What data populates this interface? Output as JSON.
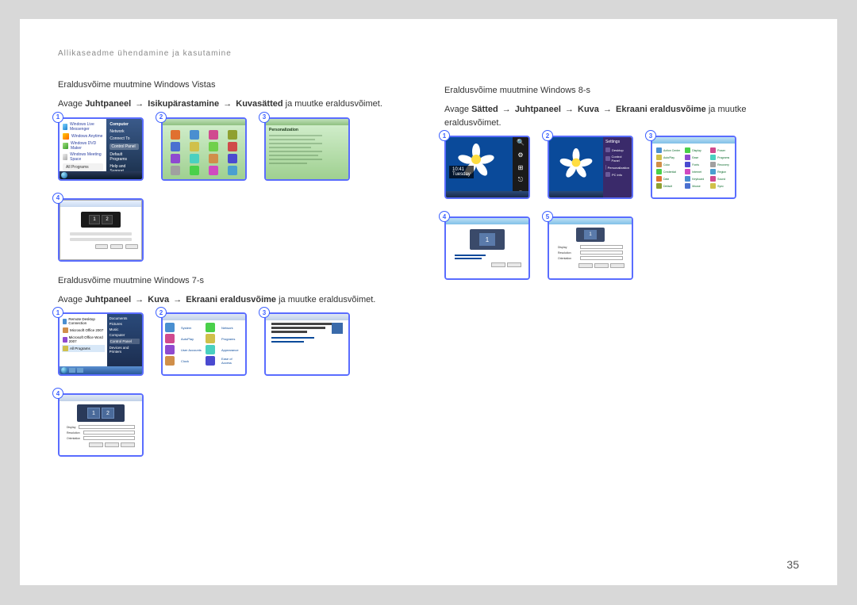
{
  "header": "Allikaseadme ühendamine ja kasutamine",
  "page_number": "35",
  "arrow": "→",
  "vista": {
    "title": "Eraldusvõime muutmine Windows Vistas",
    "desc_prefix": "Avage ",
    "path": [
      "Juhtpaneel",
      "Isikupärastamine",
      "Kuvasätted"
    ],
    "desc_suffix": " ja muutke eraldusvõimet.",
    "badges": [
      "1",
      "2",
      "3",
      "4"
    ]
  },
  "win7": {
    "title": "Eraldusvõime muutmine Windows 7-s",
    "desc_prefix": "Avage ",
    "path": [
      "Juhtpaneel",
      "Kuva",
      "Ekraani eraldusvõime"
    ],
    "desc_suffix": " ja muutke eraldusvõimet.",
    "badges": [
      "1",
      "2",
      "3",
      "4"
    ]
  },
  "win8": {
    "title": "Eraldusvõime muutmine Windows 8-s",
    "desc_prefix": "Avage ",
    "path": [
      "Sätted",
      "Juhtpaneel",
      "Kuva",
      "Ekraani eraldusvõime"
    ],
    "desc_suffix": " ja muutke eraldusvõimet.",
    "badges": [
      "1",
      "2",
      "3",
      "4",
      "5"
    ]
  }
}
